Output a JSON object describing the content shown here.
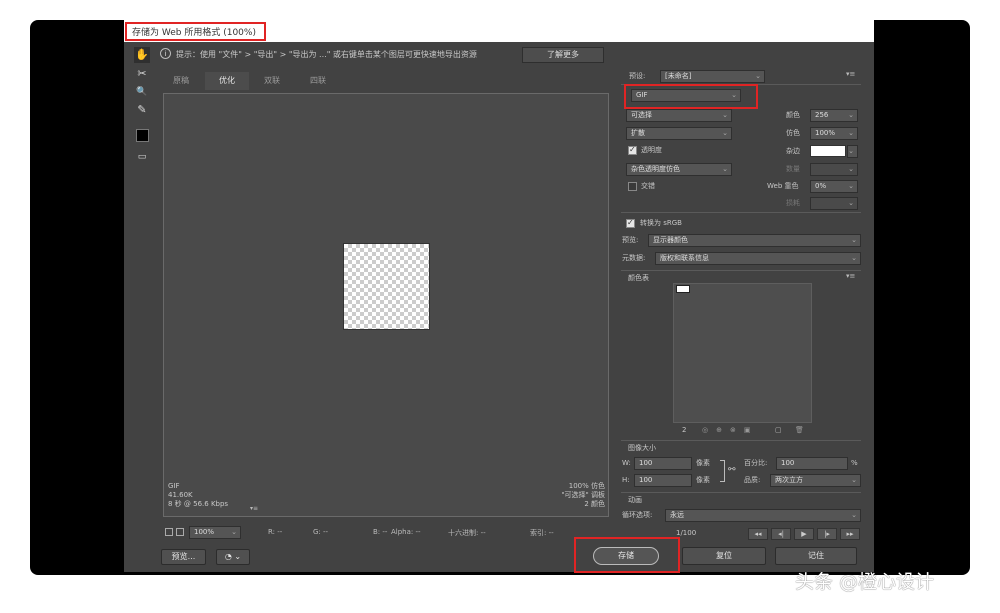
{
  "window": {
    "title": "存储为 Web 所用格式 (100%)"
  },
  "hint": {
    "text": "提示：使用 \"文件\" > \"导出\" > \"导出为 ...\" 或右键单击某个图层可更快速地导出资源",
    "learn_more": "了解更多"
  },
  "tools": {
    "hand": "✋",
    "slice": "✂",
    "zoom": "🔍",
    "eyedropper": "✎",
    "color": "■",
    "toggle": "▭"
  },
  "tabs": [
    "原稿",
    "优化",
    "双联",
    "四联"
  ],
  "active_tab": "优化",
  "preview_info": {
    "left": [
      "GIF",
      "41.60K",
      "8 秒 @ 56.6 Kbps"
    ],
    "right": [
      "100% 仿色",
      "\"可选择\" 调板",
      "2 颜色"
    ]
  },
  "bottom_bar": {
    "zoom": "100%",
    "r": "R: --",
    "g": "G: --",
    "b": "B: --",
    "alpha": "Alpha: --",
    "hex": "十六进制: --",
    "index": "索引: --"
  },
  "settings": {
    "preset_label": "预设:",
    "preset_value": "[未命名]",
    "format": "GIF",
    "reduction": "可选择",
    "dither_algo": "扩散",
    "transparency_label": "透明度",
    "matte_dither": "杂色透明度仿色",
    "interlaced_label": "交错",
    "colors_label": "颜色",
    "colors_value": "256",
    "dither_label": "仿色",
    "dither_value": "100%",
    "matte_label": "杂边",
    "amount_label": "数量",
    "websnap_label": "Web 靠色",
    "websnap_value": "0%",
    "lossy_label": "损耗",
    "convert_srgb": "转换为 sRGB",
    "preview_label": "预览:",
    "preview_value": "显示器颜色",
    "metadata_label": "元数据:",
    "metadata_value": "版权和联系信息"
  },
  "color_table": {
    "title": "颜色表",
    "count": "2"
  },
  "image_size": {
    "title": "图像大小",
    "w_label": "W:",
    "w_value": "100",
    "h_label": "H:",
    "h_value": "100",
    "unit": "像素",
    "percent_label": "百分比:",
    "percent_value": "100",
    "percent_unit": "%",
    "quality_label": "品质:",
    "quality_value": "两次立方"
  },
  "animation": {
    "title": "动画",
    "loop_label": "循环选项:",
    "loop_value": "永远",
    "frame": "1/100"
  },
  "footer": {
    "preview_btn": "预览...",
    "save": "存储",
    "reset": "复位",
    "remember": "记住"
  },
  "watermark": "头条 @橙心设计"
}
